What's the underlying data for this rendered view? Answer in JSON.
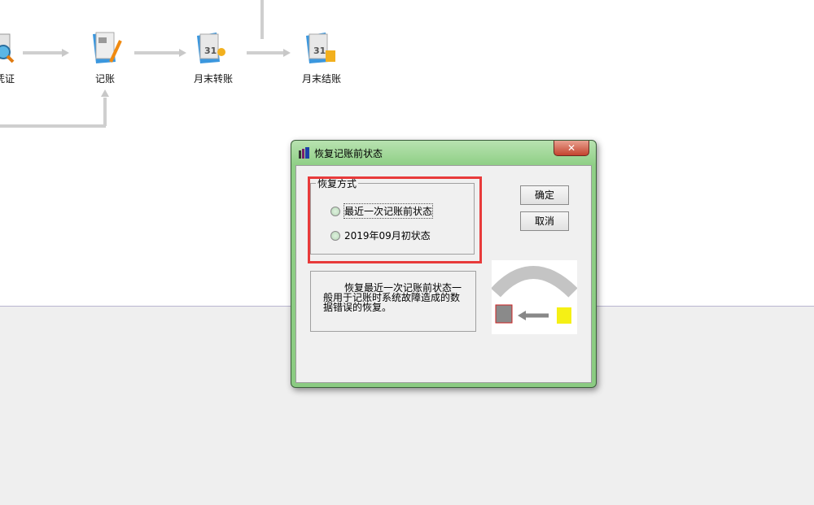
{
  "flow": {
    "items": [
      {
        "label": "凭证",
        "icon": "voucher-search-icon"
      },
      {
        "label": "记账",
        "icon": "ledger-icon"
      },
      {
        "label": "月末转账",
        "icon": "calendar-transfer-icon"
      },
      {
        "label": "月末结账",
        "icon": "calendar-coins-icon"
      }
    ]
  },
  "dialog": {
    "title": "恢复记账前状态",
    "close": "✕",
    "group_label": "恢复方式",
    "options": [
      "最近一次记账前状态",
      "2019年09月初状态"
    ],
    "ok": "确定",
    "cancel": "取消",
    "description": "恢复最近一次记账前状态一般用于记账时系统故障造成的数据错误的恢复。",
    "highlight_color": "#e83a3a"
  }
}
